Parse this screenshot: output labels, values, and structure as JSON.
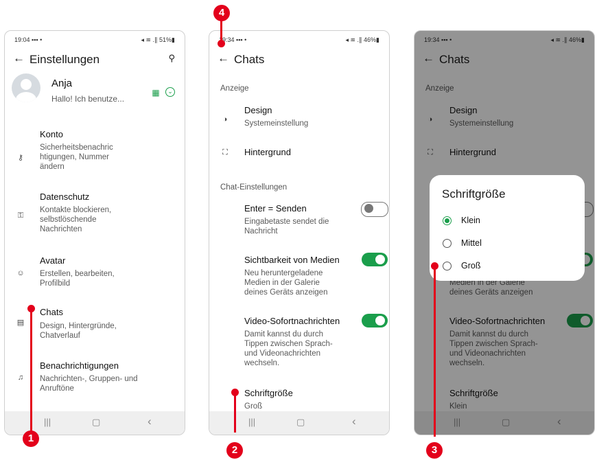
{
  "phone1": {
    "status_time": "19:04 ▪▪▪ •",
    "status_right": "◂ ≋ .∥ 51%▮",
    "title": "Einstellungen",
    "profile": {
      "name": "Anja",
      "status": "Hallo! Ich benutze..."
    },
    "items": [
      {
        "title": "Konto",
        "subtitle": "Sicherheitsbenachric\nhtigungen, Nummer\nändern"
      },
      {
        "title": "Datenschutz",
        "subtitle": "Kontakte blockieren,\nselbstlöschende\nNachrichten"
      },
      {
        "title": "Avatar",
        "subtitle": "Erstellen, bearbeiten,\nProfilbild"
      },
      {
        "title": "Chats",
        "subtitle": "Design, Hintergründe,\nChatverlauf"
      },
      {
        "title": "Benachrichtigungen",
        "subtitle": "Nachrichten-, Gruppen- und\nAnruftöne"
      }
    ]
  },
  "phone2": {
    "status_time": "19:34 ▪▪▪ •",
    "status_right": "◂ ≋ .∥ 46%▮",
    "title": "Chats",
    "section_display": "Anzeige",
    "design": {
      "title": "Design",
      "subtitle": "Systemeinstellung"
    },
    "wallpaper": "Hintergrund",
    "section_chat": "Chat-Einstellungen",
    "enter_send": {
      "title": "Enter = Senden",
      "subtitle": "Eingabetaste sendet die\nNachricht",
      "on": false
    },
    "media_visibility": {
      "title": "Sichtbarkeit von Medien",
      "subtitle": "Neu heruntergeladene\nMedien in der Galerie\ndeines Geräts anzeigen",
      "on": true
    },
    "video_msgs": {
      "title": "Video-Sofortnachrichten",
      "subtitle": "Damit kannst du durch\nTippen zwischen Sprach-\nund Videonachrichten\nwechseln.",
      "on": true
    },
    "font_size": {
      "title": "Schriftgröße",
      "value": "Groß"
    }
  },
  "phone3": {
    "status_time": "19:34 ▪▪▪ •",
    "status_right": "◂ ≋ .∥ 46%▮",
    "title": "Chats",
    "section_display": "Anzeige",
    "design": {
      "title": "Design",
      "subtitle": "Systemeinstellung"
    },
    "wallpaper": "Hintergrund",
    "media_subtitle_partial": "Medien in der Galerie\ndeines Geräts anzeigen",
    "video_msgs": {
      "title": "Video-Sofortnachrichten",
      "subtitle": "Damit kannst du durch\nTippen zwischen Sprach-\nund Videonachrichten\nwechseln."
    },
    "font_size": {
      "title": "Schriftgröße",
      "value": "Klein"
    },
    "dialog": {
      "title": "Schriftgröße",
      "options": [
        "Klein",
        "Mittel",
        "Groß"
      ],
      "selected": "Klein"
    }
  },
  "nav": {
    "recents": "|||",
    "home": "▢",
    "back": "‹"
  },
  "markers": [
    "1",
    "2",
    "3",
    "4"
  ],
  "colors": {
    "accent": "#1a9e4b",
    "marker": "#e3001b"
  }
}
